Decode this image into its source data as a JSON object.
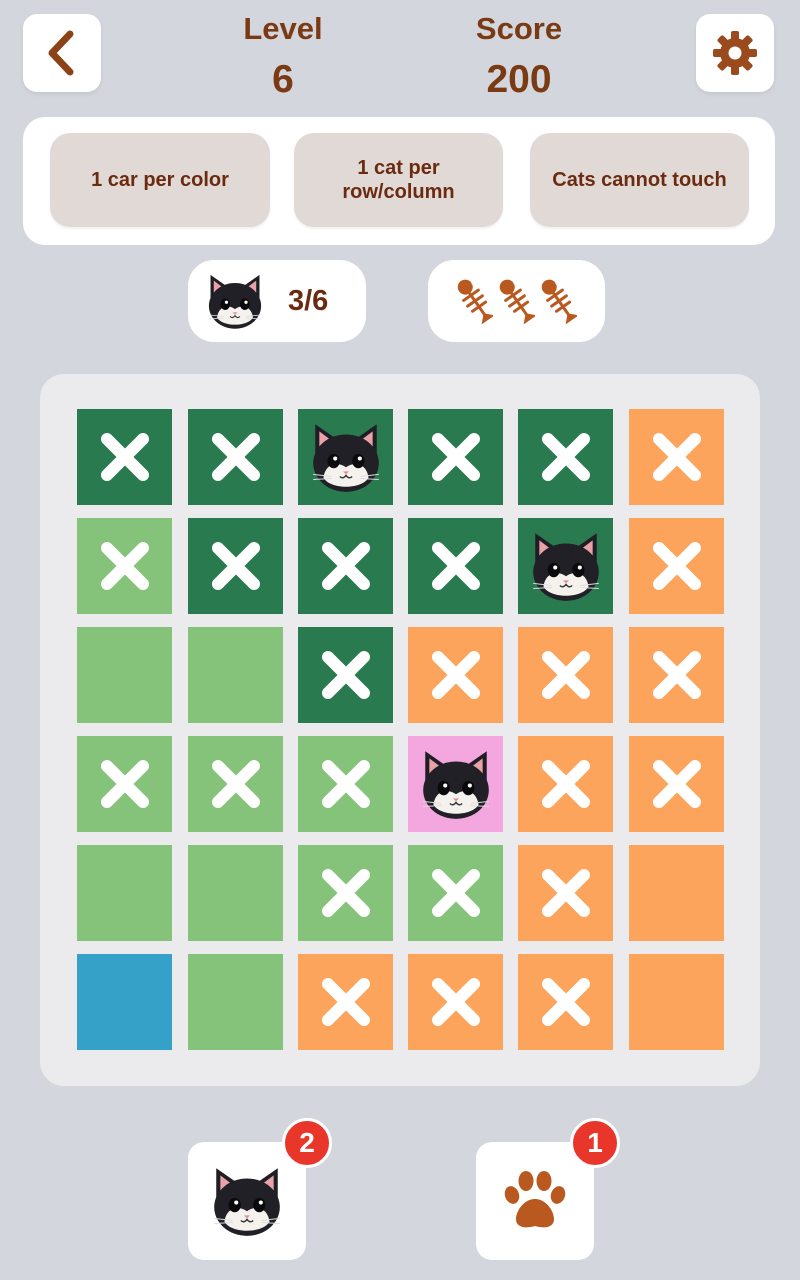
{
  "header": {
    "level_label": "Level",
    "level_value": "6",
    "score_label": "Score",
    "score_value": "200",
    "back_icon": "chevron-left-icon",
    "settings_icon": "gear-icon"
  },
  "rules": [
    {
      "line1": "1 car per color",
      "line2": ""
    },
    {
      "line1": "1 cat per",
      "line2": "row/column"
    },
    {
      "line1": "Cats cannot touch",
      "line2": ""
    }
  ],
  "status": {
    "cats_placed": "3/6",
    "fish_lives": 3
  },
  "colors": {
    "dark_green": "#2a7a50",
    "light_green": "#85c27a",
    "orange": "#fca45c",
    "pink": "#f4a6df",
    "blue": "#35a0c8",
    "text_brown": "#7a3a14",
    "badge_red": "#e8362b"
  },
  "board": {
    "rows": [
      [
        {
          "c": "dark_green",
          "s": "x"
        },
        {
          "c": "dark_green",
          "s": "x"
        },
        {
          "c": "dark_green",
          "s": "cat"
        },
        {
          "c": "dark_green",
          "s": "x"
        },
        {
          "c": "dark_green",
          "s": "x"
        },
        {
          "c": "orange",
          "s": "x"
        }
      ],
      [
        {
          "c": "light_green",
          "s": "x"
        },
        {
          "c": "dark_green",
          "s": "x"
        },
        {
          "c": "dark_green",
          "s": "x"
        },
        {
          "c": "dark_green",
          "s": "x"
        },
        {
          "c": "dark_green",
          "s": "cat"
        },
        {
          "c": "orange",
          "s": "x"
        }
      ],
      [
        {
          "c": "light_green",
          "s": ""
        },
        {
          "c": "light_green",
          "s": ""
        },
        {
          "c": "dark_green",
          "s": "x"
        },
        {
          "c": "orange",
          "s": "x"
        },
        {
          "c": "orange",
          "s": "x"
        },
        {
          "c": "orange",
          "s": "x"
        }
      ],
      [
        {
          "c": "light_green",
          "s": "x"
        },
        {
          "c": "light_green",
          "s": "x"
        },
        {
          "c": "light_green",
          "s": "x"
        },
        {
          "c": "pink",
          "s": "cat"
        },
        {
          "c": "orange",
          "s": "x"
        },
        {
          "c": "orange",
          "s": "x"
        }
      ],
      [
        {
          "c": "light_green",
          "s": ""
        },
        {
          "c": "light_green",
          "s": ""
        },
        {
          "c": "light_green",
          "s": "x"
        },
        {
          "c": "light_green",
          "s": "x"
        },
        {
          "c": "orange",
          "s": "x"
        },
        {
          "c": "orange",
          "s": ""
        }
      ],
      [
        {
          "c": "blue",
          "s": ""
        },
        {
          "c": "light_green",
          "s": ""
        },
        {
          "c": "orange",
          "s": "x"
        },
        {
          "c": "orange",
          "s": "x"
        },
        {
          "c": "orange",
          "s": "x"
        },
        {
          "c": "orange",
          "s": ""
        }
      ]
    ]
  },
  "hints": {
    "cat_hint_count": "2",
    "cat_hint_icon": "cat-face-icon",
    "paw_hint_count": "1",
    "paw_hint_icon": "paw-icon"
  }
}
